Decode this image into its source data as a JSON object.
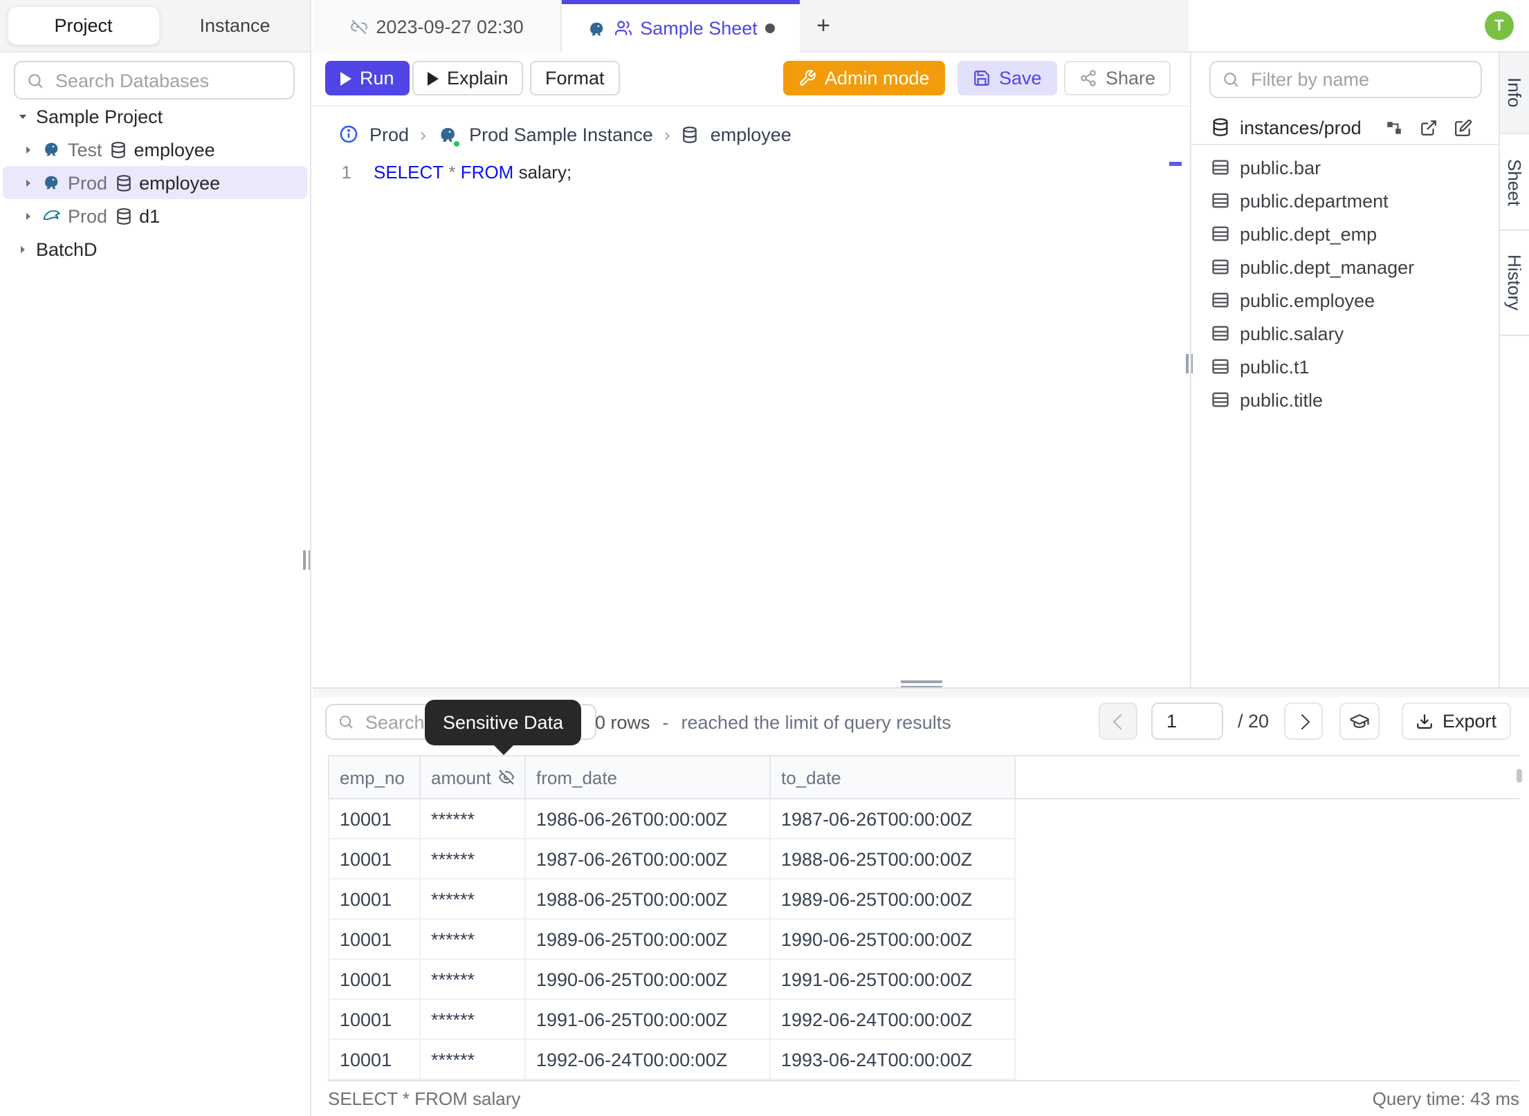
{
  "header": {
    "left_tabs": {
      "project": "Project",
      "instance": "Instance"
    },
    "avatar_initial": "T"
  },
  "sidebar": {
    "search_placeholder": "Search Databases",
    "tree": {
      "project": "Sample Project",
      "test_row": {
        "env": "Test",
        "db": "employee"
      },
      "prod_row": {
        "env": "Prod",
        "db": "employee"
      },
      "mysql_row": {
        "env": "Prod",
        "db": "d1"
      },
      "batch": "BatchD"
    }
  },
  "tabs": {
    "sheet1": "2023-09-27 02:30",
    "sheet2": "Sample Sheet",
    "new_tab": "+"
  },
  "toolbar": {
    "run": "Run",
    "explain": "Explain",
    "format": "Format",
    "admin_mode": "Admin mode",
    "save": "Save",
    "share": "Share"
  },
  "breadcrumb": {
    "environment": "Prod",
    "instance": "Prod Sample Instance",
    "database": "employee"
  },
  "editor": {
    "line_number": "1",
    "sql": {
      "kw1": "SELECT",
      "op": "*",
      "kw2": "FROM",
      "rest": "salary;"
    }
  },
  "schema_panel": {
    "filter_placeholder": "Filter by name",
    "root": "instances/prod",
    "tables": [
      "public.bar",
      "public.department",
      "public.dept_emp",
      "public.dept_manager",
      "public.employee",
      "public.salary",
      "public.t1",
      "public.title"
    ]
  },
  "right_tabs": [
    "Info",
    "Sheet",
    "History"
  ],
  "results": {
    "search_placeholder": "Search",
    "tooltip": "Sensitive Data",
    "row_count": "0 rows",
    "separator": "-",
    "limit_note": "reached the limit of query results",
    "pagination": {
      "page": "1",
      "total": "/ 20"
    },
    "export_label": "Export",
    "columns": [
      "emp_no",
      "amount",
      "from_date",
      "to_date"
    ],
    "rows": [
      {
        "emp_no": "10001",
        "amount": "******",
        "from_date": "1986-06-26T00:00:00Z",
        "to_date": "1987-06-26T00:00:00Z"
      },
      {
        "emp_no": "10001",
        "amount": "******",
        "from_date": "1987-06-26T00:00:00Z",
        "to_date": "1988-06-25T00:00:00Z"
      },
      {
        "emp_no": "10001",
        "amount": "******",
        "from_date": "1988-06-25T00:00:00Z",
        "to_date": "1989-06-25T00:00:00Z"
      },
      {
        "emp_no": "10001",
        "amount": "******",
        "from_date": "1989-06-25T00:00:00Z",
        "to_date": "1990-06-25T00:00:00Z"
      },
      {
        "emp_no": "10001",
        "amount": "******",
        "from_date": "1990-06-25T00:00:00Z",
        "to_date": "1991-06-25T00:00:00Z"
      },
      {
        "emp_no": "10001",
        "amount": "******",
        "from_date": "1991-06-25T00:00:00Z",
        "to_date": "1992-06-24T00:00:00Z"
      },
      {
        "emp_no": "10001",
        "amount": "******",
        "from_date": "1992-06-24T00:00:00Z",
        "to_date": "1993-06-24T00:00:00Z"
      }
    ],
    "status_query": "SELECT * FROM salary",
    "status_time": "Query time: 43 ms"
  },
  "colors": {
    "accent": "#4f46e5",
    "admin_orange": "#f39c0b",
    "avatar_green": "#7bc043",
    "selected_row": "#eae8fb",
    "tooltip_bg": "#28282a"
  }
}
